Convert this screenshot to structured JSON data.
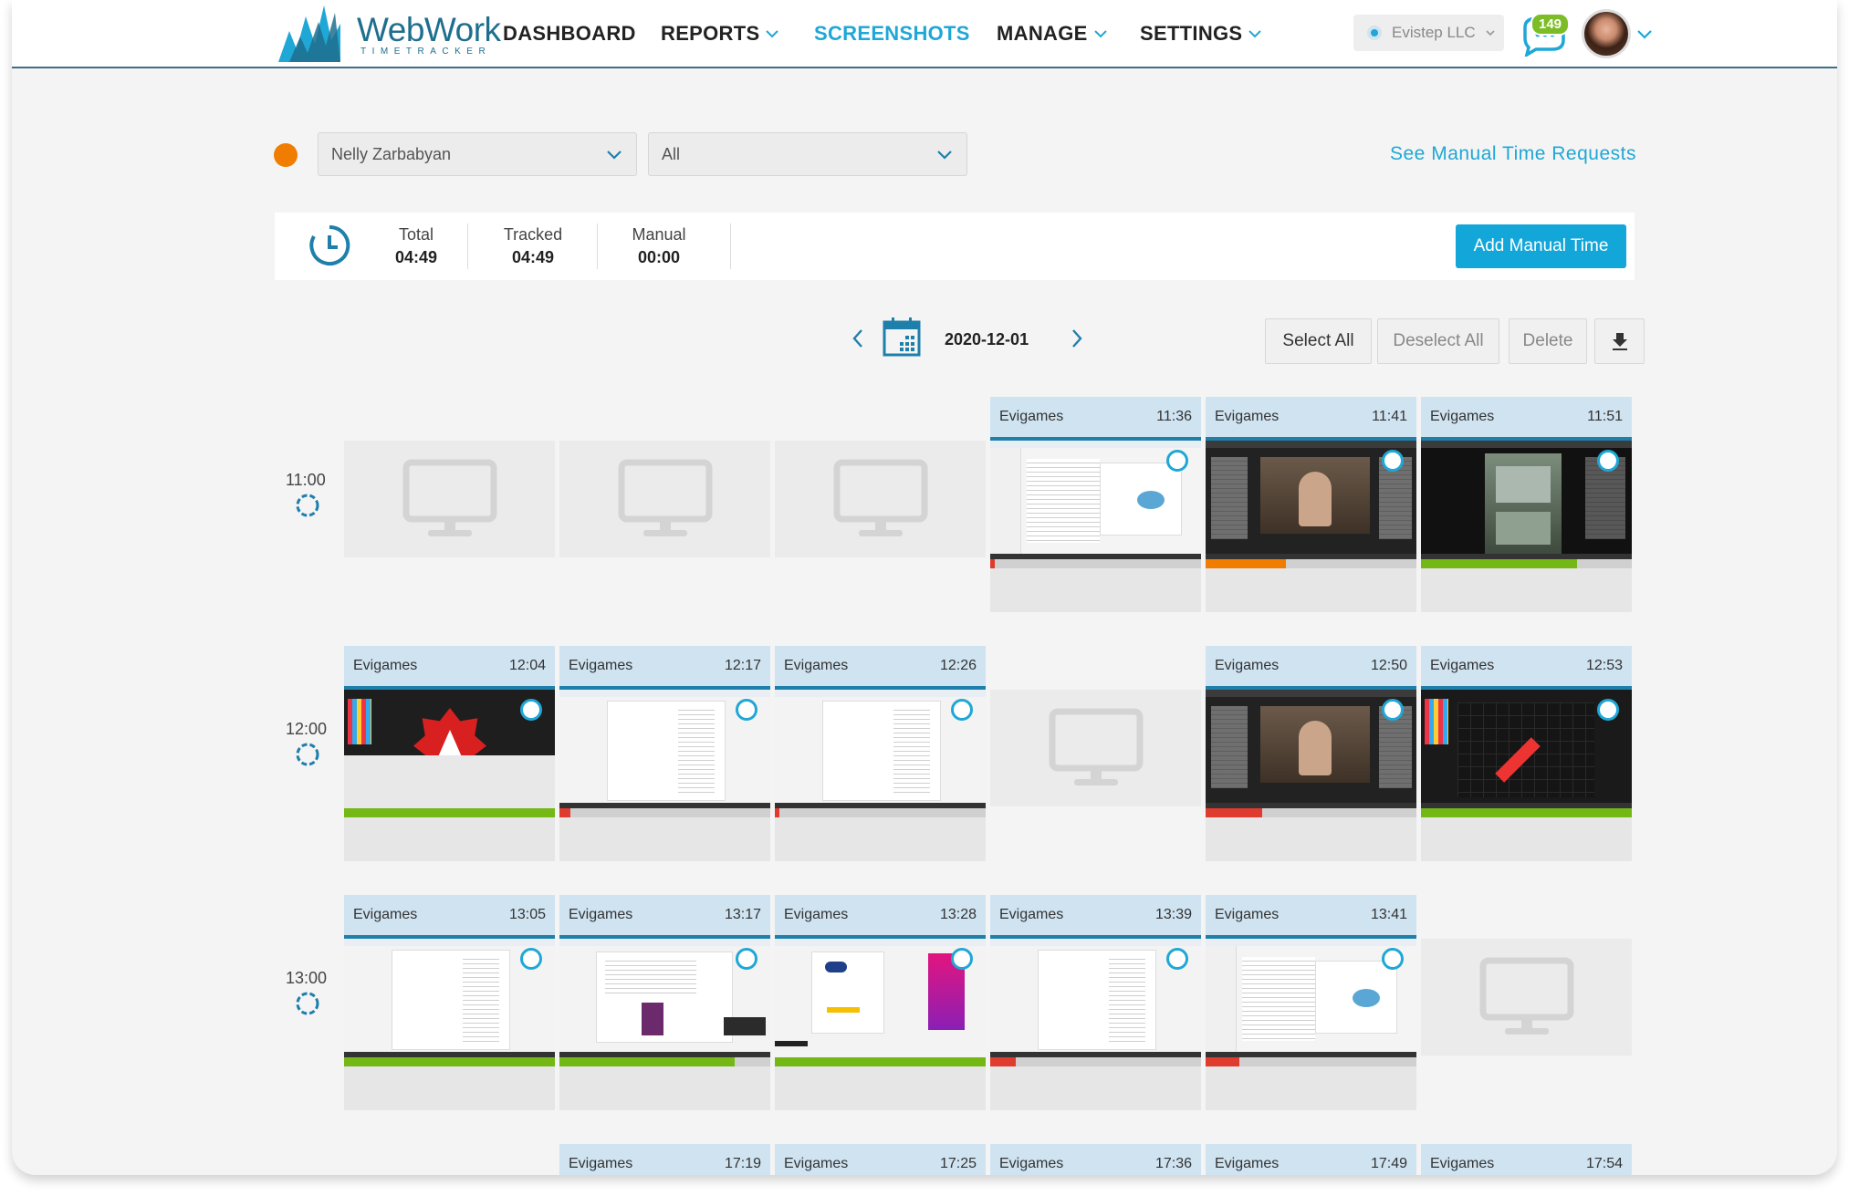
{
  "brand": {
    "name": "WebWork",
    "sub": "TIMETRACKER"
  },
  "nav": [
    {
      "label": "DASHBOARD",
      "dropdown": false,
      "active": false
    },
    {
      "label": "REPORTS",
      "dropdown": true,
      "active": false
    },
    {
      "label": "SCREENSHOTS",
      "dropdown": false,
      "active": true
    },
    {
      "label": "MANAGE",
      "dropdown": true,
      "active": false
    },
    {
      "label": "SETTINGS",
      "dropdown": true,
      "active": false
    }
  ],
  "company": "Evistep LLC",
  "notifications": "149",
  "filters": {
    "user": "Nelly Zarbabyan",
    "project": "All"
  },
  "manual_requests_link": "See Manual Time Requests",
  "totals": [
    {
      "label": "Total",
      "value": "04:49"
    },
    {
      "label": "Tracked",
      "value": "04:49"
    },
    {
      "label": "Manual",
      "value": "00:00"
    }
  ],
  "add_manual_label": "Add Manual Time",
  "date": "2020-12-01",
  "toolbar": {
    "select_all": "Select All",
    "deselect_all": "Deselect All",
    "delete": "Delete"
  },
  "hours": [
    {
      "label": "11:00",
      "slots": [
        null,
        null,
        null,
        {
          "project": "Evigames",
          "time": "11:36",
          "activity": 0.02,
          "color": "#e03b2f",
          "style": "web"
        },
        {
          "project": "Evigames",
          "time": "11:41",
          "activity": 0.38,
          "color": "#f07d00",
          "style": "video"
        },
        {
          "project": "Evigames",
          "time": "11:51",
          "activity": 0.74,
          "color": "#74b816",
          "style": "video2"
        }
      ]
    },
    {
      "label": "12:00",
      "slots": [
        {
          "project": "Evigames",
          "time": "12:04",
          "activity": 1.0,
          "color": "#74b816",
          "style": "design"
        },
        {
          "project": "Evigames",
          "time": "12:17",
          "activity": 0.05,
          "color": "#e03b2f",
          "style": "sheet"
        },
        {
          "project": "Evigames",
          "time": "12:26",
          "activity": 0.02,
          "color": "#e03b2f",
          "style": "sheet"
        },
        null,
        {
          "project": "Evigames",
          "time": "12:50",
          "activity": 0.27,
          "color": "#e03b2f",
          "style": "video"
        },
        {
          "project": "Evigames",
          "time": "12:53",
          "activity": 1.0,
          "color": "#74b816",
          "style": "design2"
        }
      ]
    },
    {
      "label": "13:00",
      "slots": [
        {
          "project": "Evigames",
          "time": "13:05",
          "activity": 1.0,
          "color": "#74b816",
          "style": "sheet"
        },
        {
          "project": "Evigames",
          "time": "13:17",
          "activity": 0.83,
          "color": "#74b816",
          "style": "files"
        },
        {
          "project": "Evigames",
          "time": "13:28",
          "activity": 1.0,
          "color": "#74b816",
          "style": "poster"
        },
        {
          "project": "Evigames",
          "time": "13:39",
          "activity": 0.12,
          "color": "#e03b2f",
          "style": "sheet"
        },
        {
          "project": "Evigames",
          "time": "13:41",
          "activity": 0.16,
          "color": "#e03b2f",
          "style": "web"
        },
        null
      ]
    },
    {
      "label": "",
      "slots": [
        null,
        {
          "project": "Evigames",
          "time": "17:19"
        },
        {
          "project": "Evigames",
          "time": "17:25"
        },
        {
          "project": "Evigames",
          "time": "17:36"
        },
        {
          "project": "Evigames",
          "time": "17:49"
        },
        {
          "project": "Evigames",
          "time": "17:54"
        }
      ]
    }
  ]
}
